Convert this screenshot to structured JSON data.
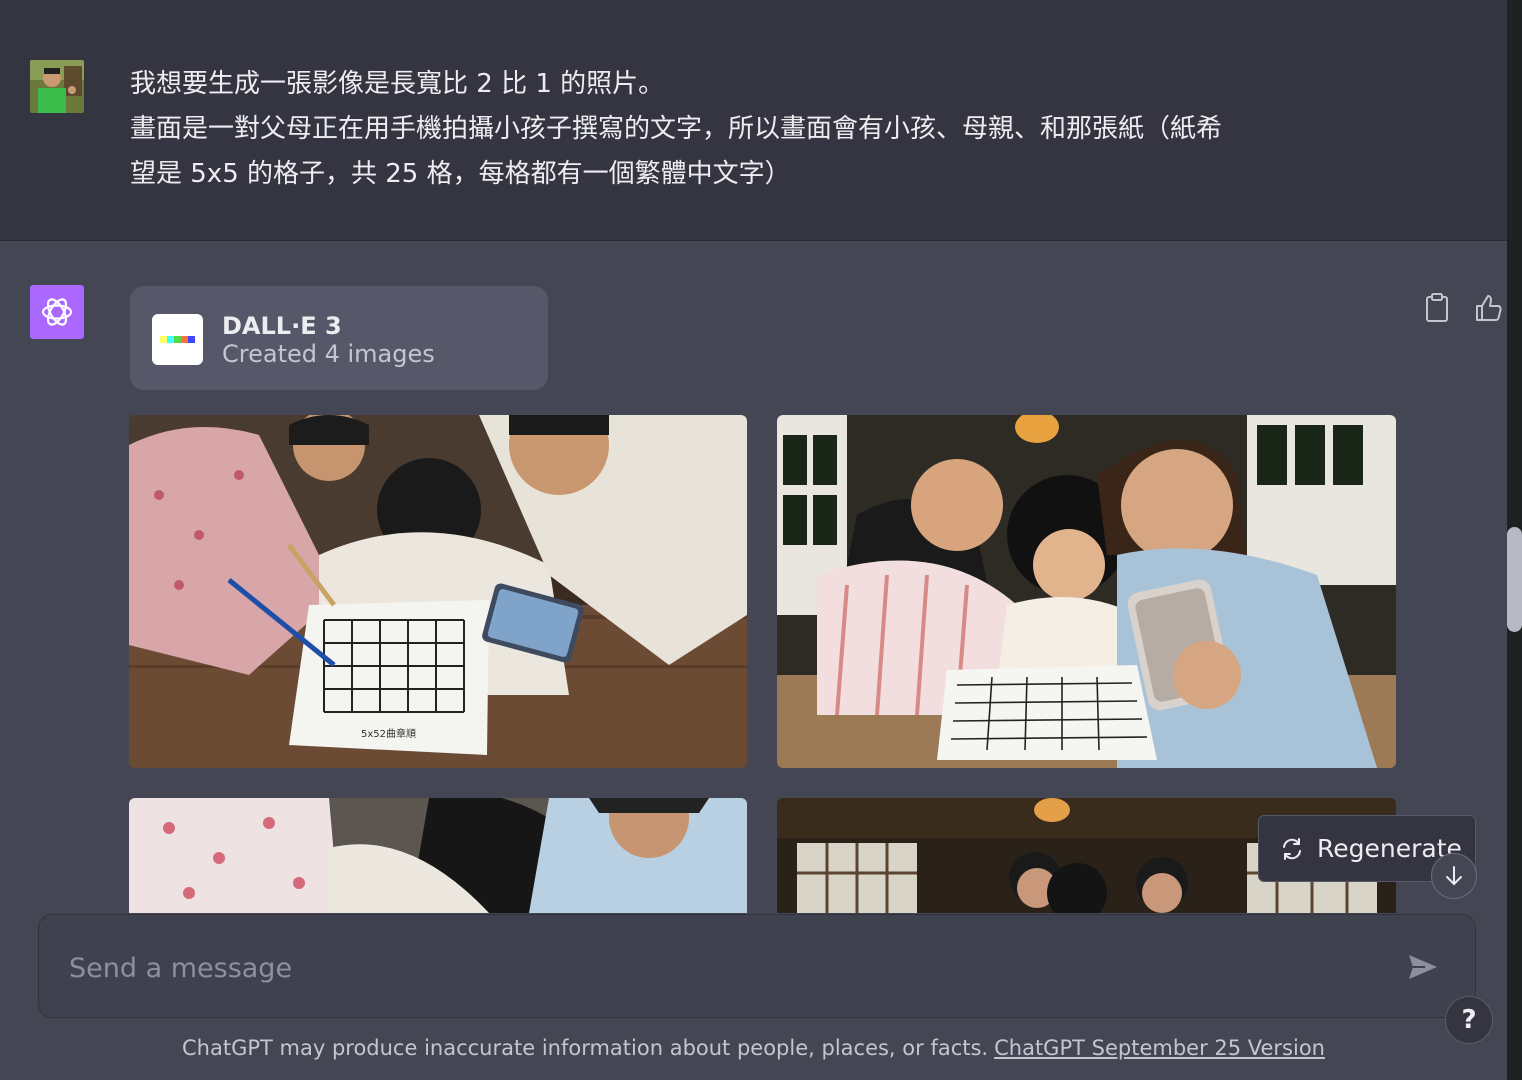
{
  "user_message": {
    "lines": [
      "我想要生成一張影像是長寬比 2 比 1 的照片。",
      "畫面是一對父母正在用手機拍攝小孩子撰寫的文字，所以畫面會有小孩、母親、和那張紙（紙希",
      "望是 5x5 的格子，共 25 格，每格都有一個繁體中文字）"
    ]
  },
  "assistant": {
    "tool": {
      "name": "DALL·E 3",
      "status": "Created 4 images"
    },
    "actions": [
      "clipboard-icon",
      "thumbs-up-icon"
    ],
    "images": [
      {
        "name": "generated-image-1",
        "paper_caption": "5x52曲章順"
      },
      {
        "name": "generated-image-2"
      },
      {
        "name": "generated-image-3"
      },
      {
        "name": "generated-image-4"
      }
    ]
  },
  "regenerate_label": "Regenerate",
  "composer": {
    "placeholder": "Send a message"
  },
  "footer": {
    "text": "ChatGPT may produce inaccurate information about people, places, or facts.",
    "link": "ChatGPT September 25 Version"
  },
  "help_label": "?",
  "colors": {
    "accent_purple": "#ab68ff",
    "bg_user": "#343541",
    "bg_assistant": "#444654"
  }
}
